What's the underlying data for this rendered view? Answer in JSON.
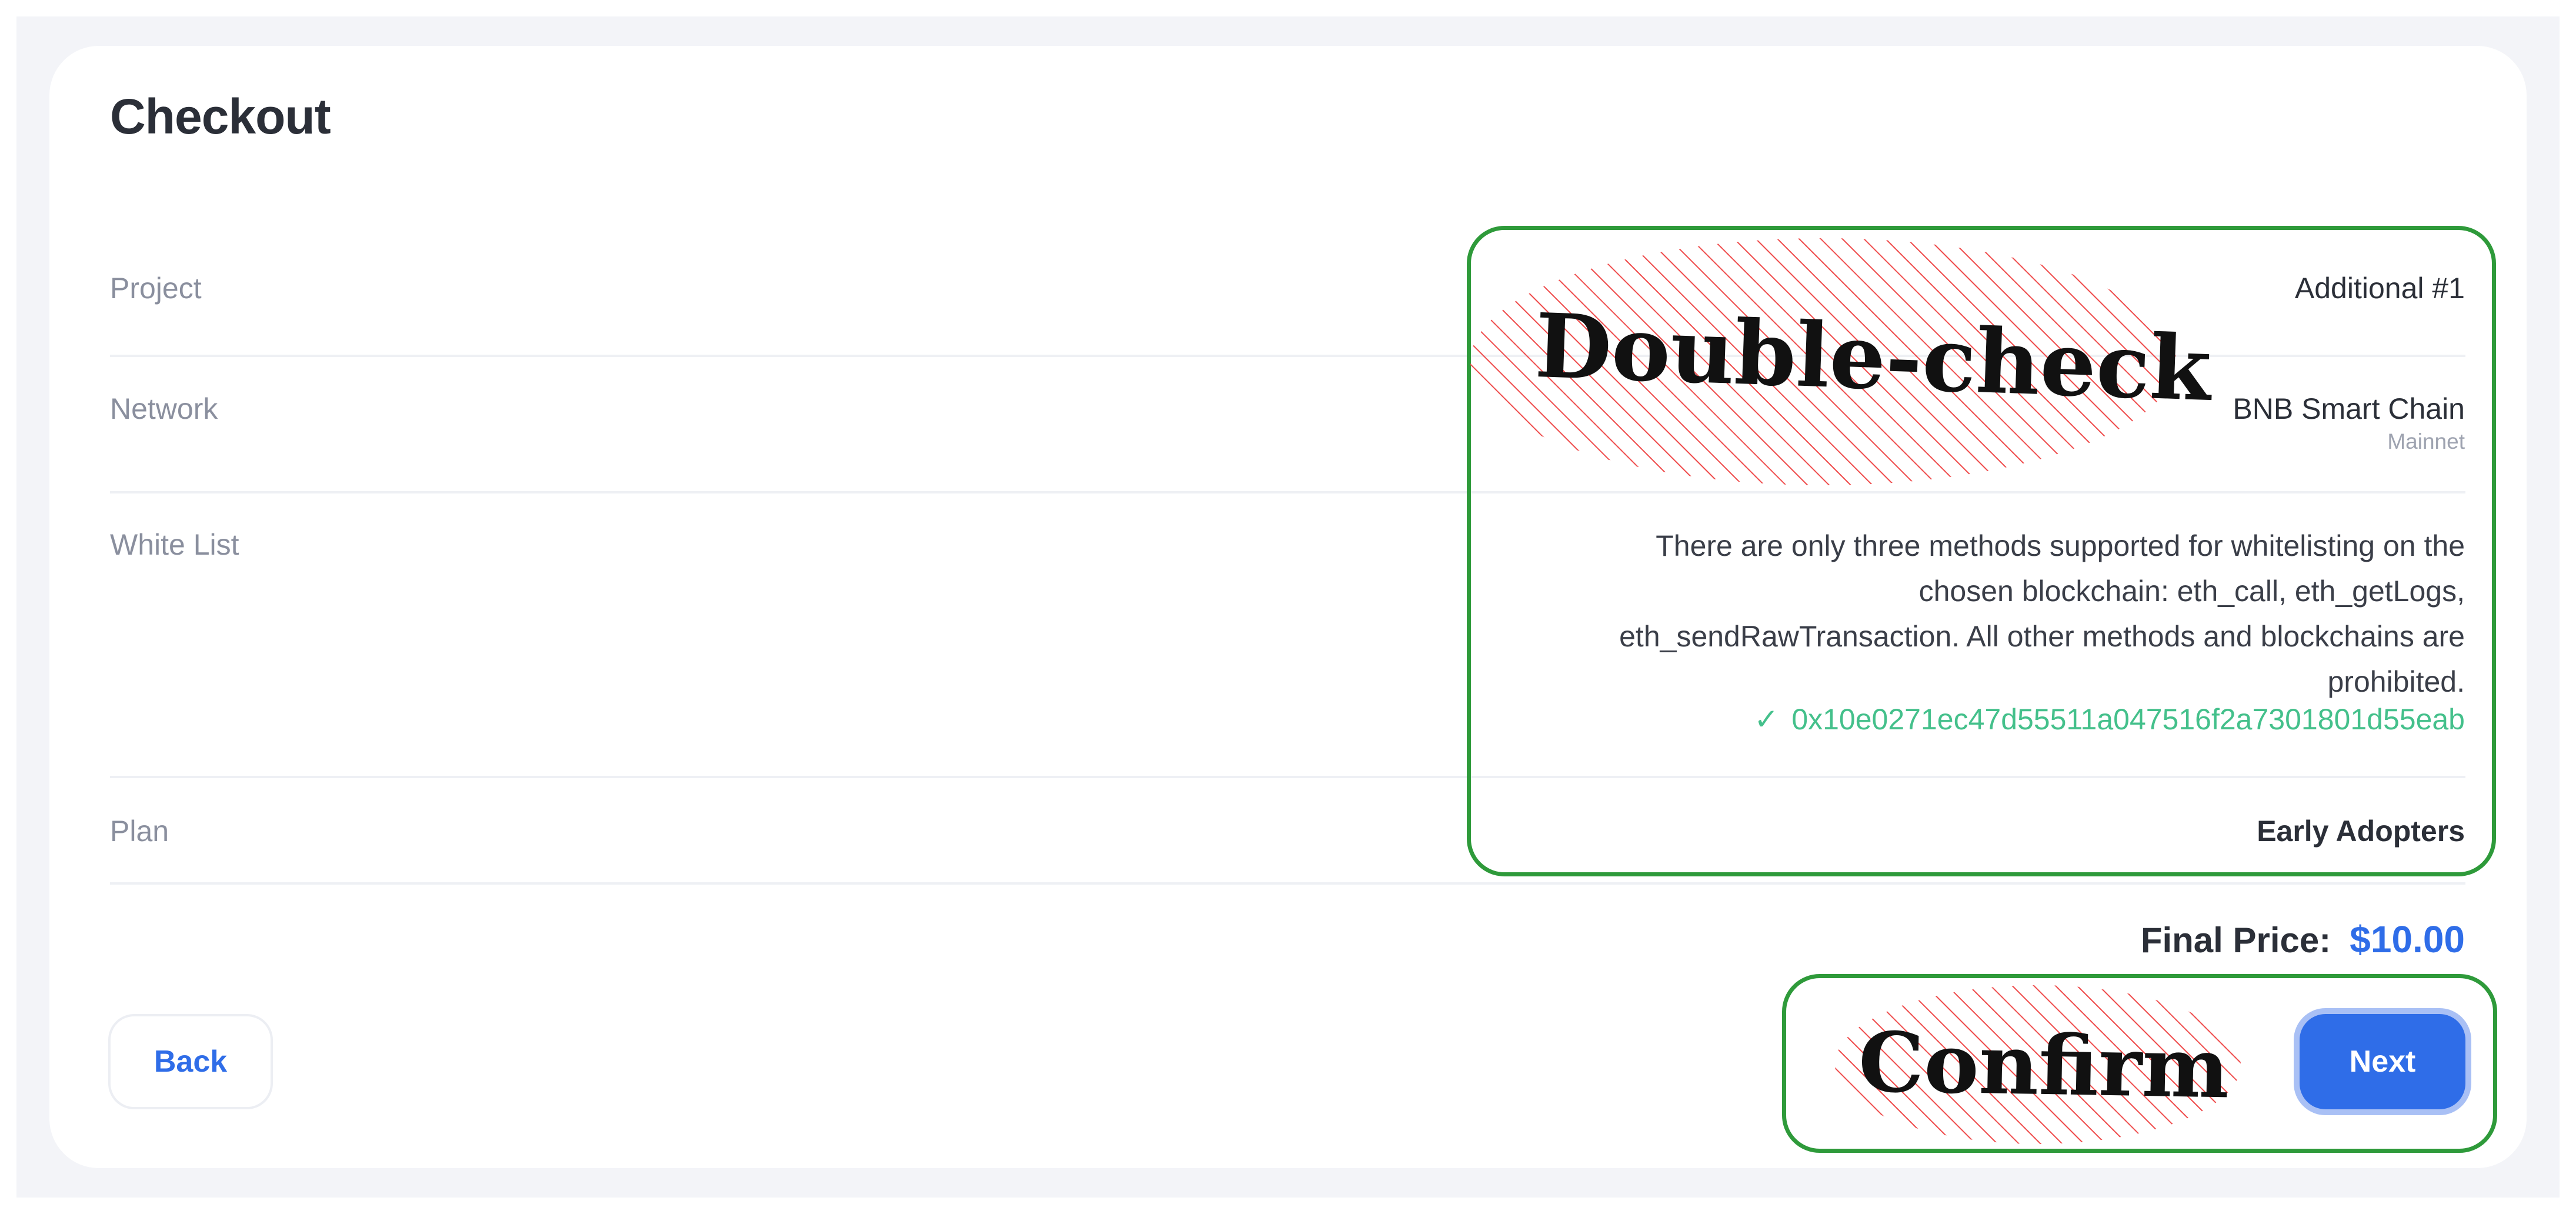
{
  "checkout": {
    "title": "Checkout",
    "rows": {
      "project": {
        "label": "Project",
        "value": "Additional #1"
      },
      "network": {
        "label": "Network",
        "value": "BNB Smart Chain",
        "subvalue": "Mainnet"
      },
      "whitelist": {
        "label": "White List",
        "description": "There are only three methods supported for whitelisting on the chosen blockchain: eth_call, eth_getLogs, eth_sendRawTransaction. All other methods and blockchains are prohibited.",
        "check_glyph": "✓",
        "address": "0x10e0271ec47d55511a047516f2a7301801d55eab"
      },
      "plan": {
        "label": "Plan",
        "value": "Early Adopters"
      }
    },
    "final_price": {
      "label": "Final Price:",
      "amount": "$10.00"
    },
    "buttons": {
      "back": "Back",
      "next": "Next"
    }
  },
  "annotations": {
    "top": "Double-check",
    "bottom": "Confirm"
  },
  "colors": {
    "accent": "#2f6de8",
    "success": "#44c08b",
    "annotation_box": "#2e9a3a",
    "annotation_hatch": "#ef4b4b"
  },
  "icons": {
    "whitelist_check": "check-icon"
  }
}
